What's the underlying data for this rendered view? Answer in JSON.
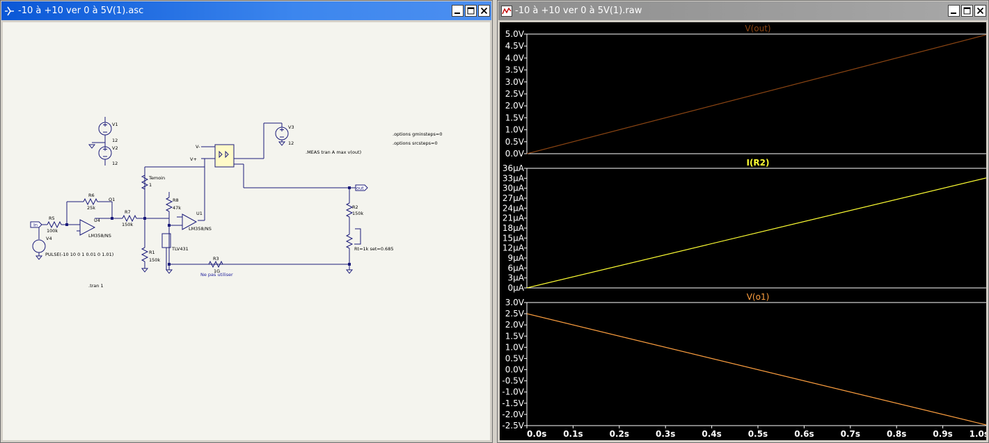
{
  "schematic_window": {
    "title": "-10 à +10 ver 0 à 5V(1).asc",
    "labels": {
      "v1": "V1",
      "v1_val": "12",
      "v2": "V2",
      "v2_val": "12",
      "v3": "V3",
      "v3_val": "12",
      "v4": "V4",
      "v4_source": "PULSE(-10 10 0 1 0.01 0 1.01)",
      "r5": "R5",
      "r5_val": "100k",
      "r6": "R6",
      "r6_val": "25k",
      "r7": "R7",
      "r7_val": "150k",
      "r1": "R1",
      "r1_val": "150k",
      "r8": "R8",
      "r8_val": "47k",
      "r2": "R2",
      "r2_val": "150k",
      "r3": "R3",
      "r3_val": "1G",
      "r3_note": "Ne pas utiliser",
      "rt": "Rt=1k set=0.685",
      "u4": "U4",
      "u4_model": "LM358/NS",
      "u1": "U1",
      "u1_model": "LM358/NS",
      "tl431": "TLV431",
      "temoin": "Temoin",
      "temoin_val": "1",
      "o1": "O1",
      "in_port": "In",
      "out_port": "out",
      "vminus": "V-",
      "vplus": "V+",
      "meas": ".MEAS tran A max v(out)",
      "opt1": ".options gminsteps=0",
      "opt2": ".options srcsteps=0",
      "tran": ".tran 1"
    }
  },
  "waveform_window": {
    "title": "-10 à +10 ver 0 à 5V(1).raw"
  },
  "chart_data": [
    {
      "type": "line",
      "title": "V(out)",
      "color": "#8b4513",
      "x": [
        0,
        1.0
      ],
      "y": [
        0,
        5.0
      ],
      "ylim": [
        0,
        5.0
      ],
      "yticks": [
        "0.0V",
        "0.5V",
        "1.0V",
        "1.5V",
        "2.0V",
        "2.5V",
        "3.0V",
        "3.5V",
        "4.0V",
        "4.5V",
        "5.0V"
      ]
    },
    {
      "type": "line",
      "title": "I(R2)",
      "color": "#ffff33",
      "x": [
        0,
        1.0
      ],
      "y": [
        0,
        33.3
      ],
      "ylim": [
        0,
        36
      ],
      "yticks": [
        "0µA",
        "3µA",
        "6µA",
        "9µA",
        "12µA",
        "15µA",
        "18µA",
        "21µA",
        "24µA",
        "27µA",
        "30µA",
        "33µA",
        "36µA"
      ]
    },
    {
      "type": "line",
      "title": "V(o1)",
      "color": "#ffa040",
      "x": [
        0,
        1.0
      ],
      "y": [
        2.5,
        -2.5
      ],
      "ylim": [
        -2.5,
        3.0
      ],
      "yticks": [
        "-2.5V",
        "-2.0V",
        "-1.5V",
        "-1.0V",
        "-0.5V",
        "0.0V",
        "0.5V",
        "1.0V",
        "1.5V",
        "2.0V",
        "2.5V",
        "3.0V"
      ],
      "xlim": [
        0,
        1.0
      ],
      "xticks": [
        "0.0s",
        "0.1s",
        "0.2s",
        "0.3s",
        "0.4s",
        "0.5s",
        "0.6s",
        "0.7s",
        "0.8s",
        "0.9s",
        "1.0s"
      ]
    }
  ]
}
